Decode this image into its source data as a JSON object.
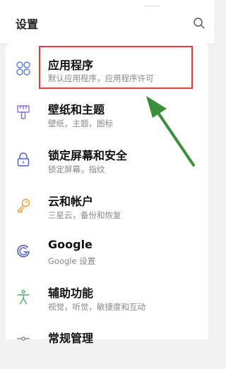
{
  "header": {
    "title": "设置"
  },
  "items": [
    {
      "title": "应用程序",
      "subtitle": "默认应用程序，应用程序许可",
      "icon": "apps-grid-icon"
    },
    {
      "title": "壁纸和主题",
      "subtitle": "壁纸，主题，图标",
      "icon": "paint-brush-icon"
    },
    {
      "title": "锁定屏幕和安全",
      "subtitle": "锁定屏幕，指纹",
      "icon": "lock-icon"
    },
    {
      "title": "云和帐户",
      "subtitle": "三星云，备份和恢复",
      "icon": "key-icon"
    },
    {
      "title": "Google",
      "subtitle": "Google 设置",
      "icon": "google-icon"
    },
    {
      "title": "辅助功能",
      "subtitle": "视觉，听觉，敏捷度和互动",
      "icon": "accessibility-icon"
    },
    {
      "title": "常规管理",
      "subtitle": "",
      "icon": "general-management-icon"
    }
  ],
  "colors": {
    "icon_accent": "#4f5ccf",
    "icon_purple": "#8c6bd6",
    "icon_orange": "#f29a38",
    "icon_green": "#4bb36b",
    "highlight": "#e63b3b",
    "arrow": "#3c8f3c"
  }
}
